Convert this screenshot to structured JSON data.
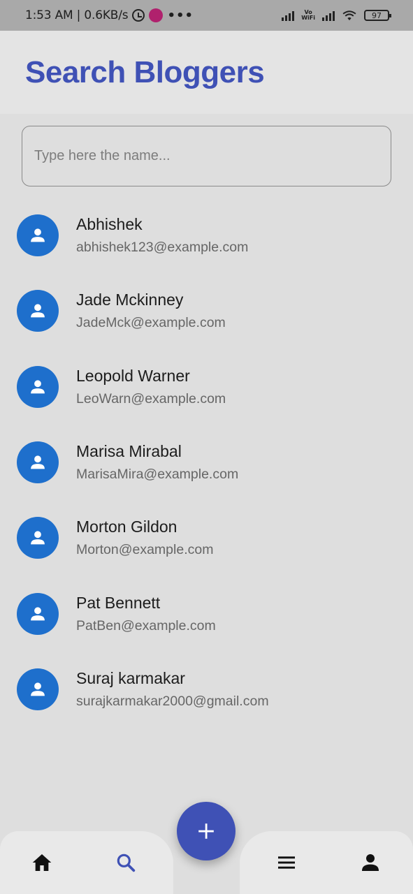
{
  "status_bar": {
    "time_speed": "1:53 AM | 0.6KB/s",
    "more": "•••",
    "vowifi_top": "Vo",
    "vowifi_bottom": "WiFi",
    "battery": "97"
  },
  "header": {
    "title": "Search Bloggers"
  },
  "search": {
    "placeholder": "Type here the name...",
    "value": ""
  },
  "bloggers": [
    {
      "name": "Abhishek",
      "email": "abhishek123@example.com"
    },
    {
      "name": "Jade Mckinney",
      "email": "JadeMck@example.com"
    },
    {
      "name": "Leopold Warner",
      "email": "LeoWarn@example.com"
    },
    {
      "name": "Marisa Mirabal",
      "email": "MarisaMira@example.com"
    },
    {
      "name": "Morton Gildon",
      "email": "Morton@example.com"
    },
    {
      "name": "Pat Bennett",
      "email": "PatBen@example.com"
    },
    {
      "name": "Suraj karmakar",
      "email": "surajkarmakar2000@gmail.com"
    }
  ],
  "bottom_nav": {
    "items": [
      {
        "icon": "home-icon",
        "active": false
      },
      {
        "icon": "search-icon",
        "active": true
      },
      {
        "icon": "menu-icon",
        "active": false
      },
      {
        "icon": "person-icon",
        "active": false
      }
    ],
    "fab_icon": "plus-icon"
  },
  "colors": {
    "accent": "#3f51b5",
    "avatar": "#1e6fcc",
    "background": "#dedede",
    "status_bar": "#a9a9a9"
  }
}
